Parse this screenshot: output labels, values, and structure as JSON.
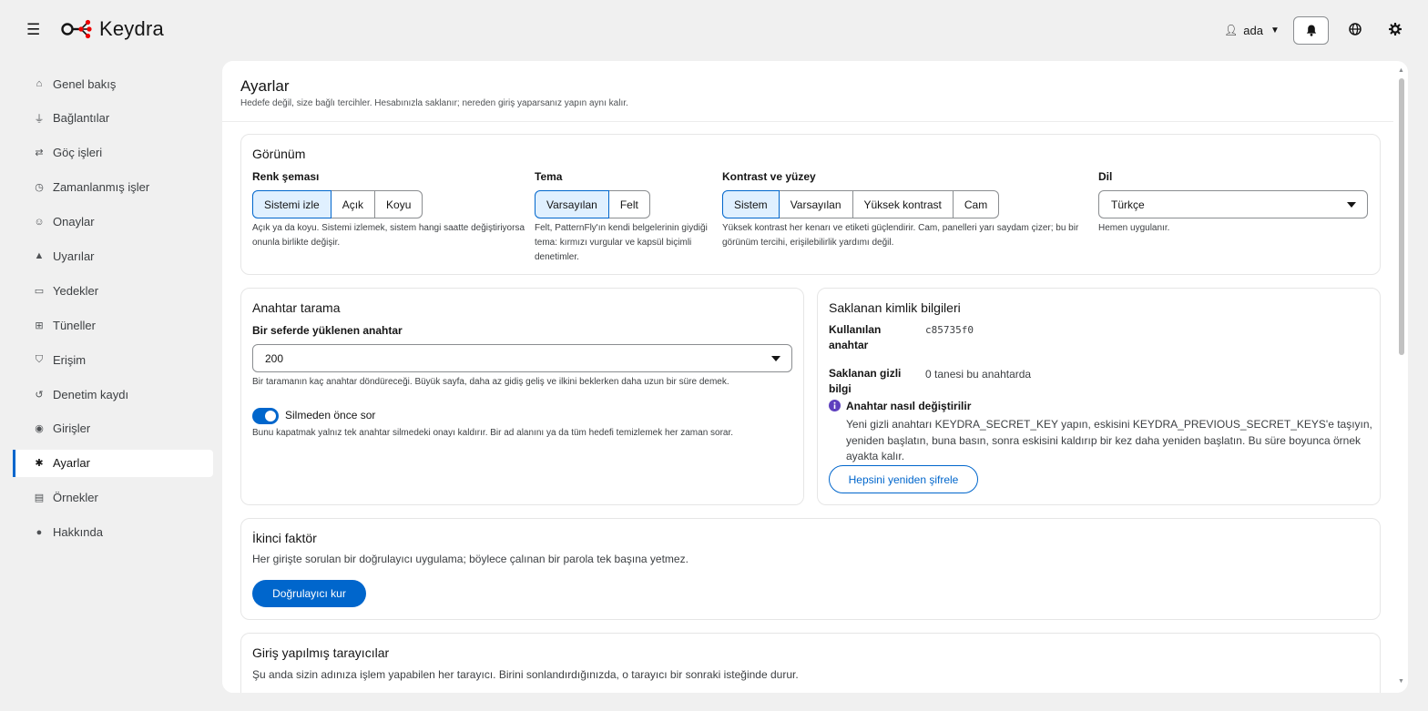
{
  "header": {
    "app_name": "Keydra",
    "user": "ada"
  },
  "sidebar": {
    "items": [
      {
        "label": "Genel bakış",
        "icon": "home-icon"
      },
      {
        "label": "Bağlantılar",
        "icon": "plug-icon"
      },
      {
        "label": "Göç işleri",
        "icon": "swap-icon"
      },
      {
        "label": "Zamanlanmış işler",
        "icon": "clock-icon"
      },
      {
        "label": "Onaylar",
        "icon": "user-check-icon"
      },
      {
        "label": "Uyarılar",
        "icon": "bell-icon"
      },
      {
        "label": "Yedekler",
        "icon": "hdd-icon"
      },
      {
        "label": "Tüneller",
        "icon": "network-icon"
      },
      {
        "label": "Erişim",
        "icon": "shield-icon"
      },
      {
        "label": "Denetim kaydı",
        "icon": "history-icon"
      },
      {
        "label": "Girişler",
        "icon": "fingerprint-icon"
      },
      {
        "label": "Ayarlar",
        "icon": "gear-icon"
      },
      {
        "label": "Örnekler",
        "icon": "newspaper-icon"
      },
      {
        "label": "Hakkında",
        "icon": "info-icon"
      }
    ],
    "active": "Ayarlar"
  },
  "page": {
    "title": "Ayarlar",
    "subtitle": "Hedefe değil, size bağlı tercihler. Hesabınızla saklanır; nereden giriş yaparsanız yapın aynı kalır."
  },
  "appearance": {
    "title": "Görünüm",
    "color_scheme": {
      "label": "Renk şeması",
      "options": [
        "Sistemi izle",
        "Açık",
        "Koyu"
      ],
      "selected": "Sistemi izle",
      "help": "Açık ya da koyu. Sistemi izlemek, sistem hangi saatte değiştiriyorsa onunla birlikte değişir."
    },
    "theme": {
      "label": "Tema",
      "options": [
        "Varsayılan",
        "Felt"
      ],
      "selected": "Varsayılan",
      "help": "Felt, PatternFly'ın kendi belgelerinin giydiği tema: kırmızı vurgular ve kapsül biçimli denetimler."
    },
    "contrast": {
      "label": "Kontrast ve yüzey",
      "options": [
        "Sistem",
        "Varsayılan",
        "Yüksek kontrast",
        "Cam"
      ],
      "selected": "Sistem",
      "help": "Yüksek kontrast her kenarı ve etiketi güçlendirir. Cam, panelleri yarı saydam çizer; bu bir görünüm tercihi, erişilebilirlik yardımı değil."
    },
    "language": {
      "label": "Dil",
      "value": "Türkçe",
      "help": "Hemen uygulanır."
    }
  },
  "key_scan": {
    "title": "Anahtar tarama",
    "batch_label": "Bir seferde yüklenen anahtar",
    "batch_value": "200",
    "batch_help": "Bir taramanın kaç anahtar döndüreceği. Büyük sayfa, daha az gidiş geliş ve ilkini beklerken daha uzun bir süre demek.",
    "confirm_label": "Silmeden önce sor",
    "confirm_on": true,
    "confirm_help": "Bunu kapatmak yalnız tek anahtar silmedeki onayı kaldırır. Bir ad alanını ya da tüm hedefi temizlemek her zaman sorar."
  },
  "credentials": {
    "title": "Saklanan kimlik bilgileri",
    "used_key_label": "Kullanılan anahtar",
    "used_key_value": "c85735f0",
    "stored_label": "Saklanan gizli bilgi",
    "stored_value": "0 tanesi bu anahtarda",
    "howto_title": "Anahtar nasıl değiştirilir",
    "howto_text": "Yeni gizli anahtarı KEYDRA_SECRET_KEY yapın, eskisini KEYDRA_PREVIOUS_SECRET_KEYS'e taşıyın, yeniden başlatın, buna basın, sonra eskisini kaldırıp bir kez daha yeniden başlatın. Bu süre boyunca örnek ayakta kalır.",
    "reencrypt_button": "Hepsini yeniden şifrele"
  },
  "two_factor": {
    "title": "İkinci faktör",
    "description": "Her girişte sorulan bir doğrulayıcı uygulama; böylece çalınan bir parola tek başına yetmez.",
    "button": "Doğrulayıcı kur"
  },
  "browsers": {
    "title": "Giriş yapılmış tarayıcılar",
    "description": "Şu anda sizin adınıza işlem yapabilen her tarayıcı. Birini sonlandırdığınızda, o tarayıcı bir sonraki isteğinde durur."
  },
  "colors": {
    "accent": "#0066cc",
    "selected_bg": "#e0f0ff",
    "info_icon": "#5e40be",
    "logo_red": "#ee0000"
  }
}
